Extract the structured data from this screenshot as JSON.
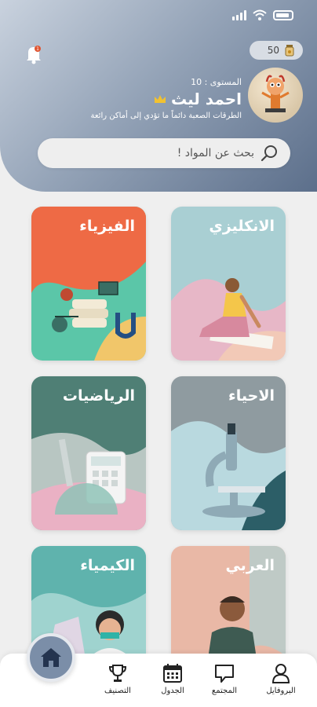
{
  "header": {
    "level_text": "المستوى : 10",
    "user_name": "احمد ليث",
    "tagline": "الطرقات الصعبة دائماً ما تؤدي إلى أماكن رائعة",
    "coins": "50"
  },
  "search": {
    "placeholder": "بحث عن المواد !"
  },
  "subjects": [
    {
      "title": "الانكليزي"
    },
    {
      "title": "الفيزياء"
    },
    {
      "title": "الاحياء"
    },
    {
      "title": "الرياضيات"
    },
    {
      "title": "العربي"
    },
    {
      "title": "الكيمياء"
    }
  ],
  "bottom_nav": {
    "profile": "البروفايل",
    "community": "المجتمع",
    "schedule": "الجدول",
    "ranking": "التصنيف"
  },
  "colors": {
    "header_dark": "#5c6f8b",
    "header_light": "#c9d2de",
    "home_fab": "#7b8ea8"
  }
}
